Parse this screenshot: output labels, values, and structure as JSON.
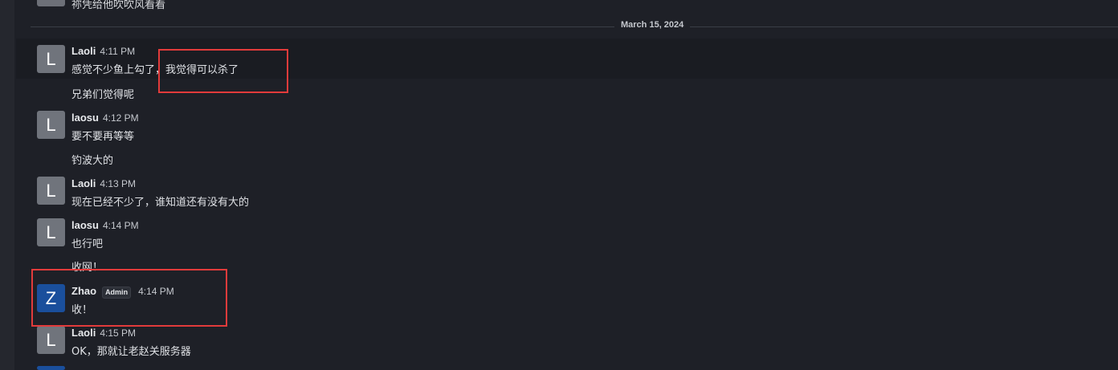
{
  "prev_message": {
    "text": "祢凭给他吹吹风看看"
  },
  "date_divider": "March 15, 2024",
  "messages": [
    {
      "author": "Laoli",
      "time": "4:11 PM",
      "avatar": "L",
      "lines": [
        "感觉不少鱼上勾了，我觉得可以杀了",
        "兄弟们觉得呢"
      ]
    },
    {
      "author": "laosu",
      "time": "4:12 PM",
      "avatar": "L",
      "lines": [
        "要不要再等等",
        "钓波大的"
      ]
    },
    {
      "author": "Laoli",
      "time": "4:13 PM",
      "avatar": "L",
      "lines": [
        "现在已经不少了，谁知道还有没有大的"
      ]
    },
    {
      "author": "laosu",
      "time": "4:14 PM",
      "avatar": "L",
      "lines": [
        "也行吧",
        "收网！"
      ]
    },
    {
      "author": "Zhao",
      "badge": "Admin",
      "time": "4:14 PM",
      "avatar": "Z",
      "lines": [
        "收！"
      ]
    },
    {
      "author": "Laoli",
      "time": "4:15 PM",
      "avatar": "L",
      "lines": [
        "OK，那就让老赵关服务器"
      ]
    }
  ],
  "colors": {
    "background": "#1e2027",
    "admin_avatar": "#1a4f9c",
    "user_avatar": "#70747c",
    "highlight": "#e23b3b"
  }
}
